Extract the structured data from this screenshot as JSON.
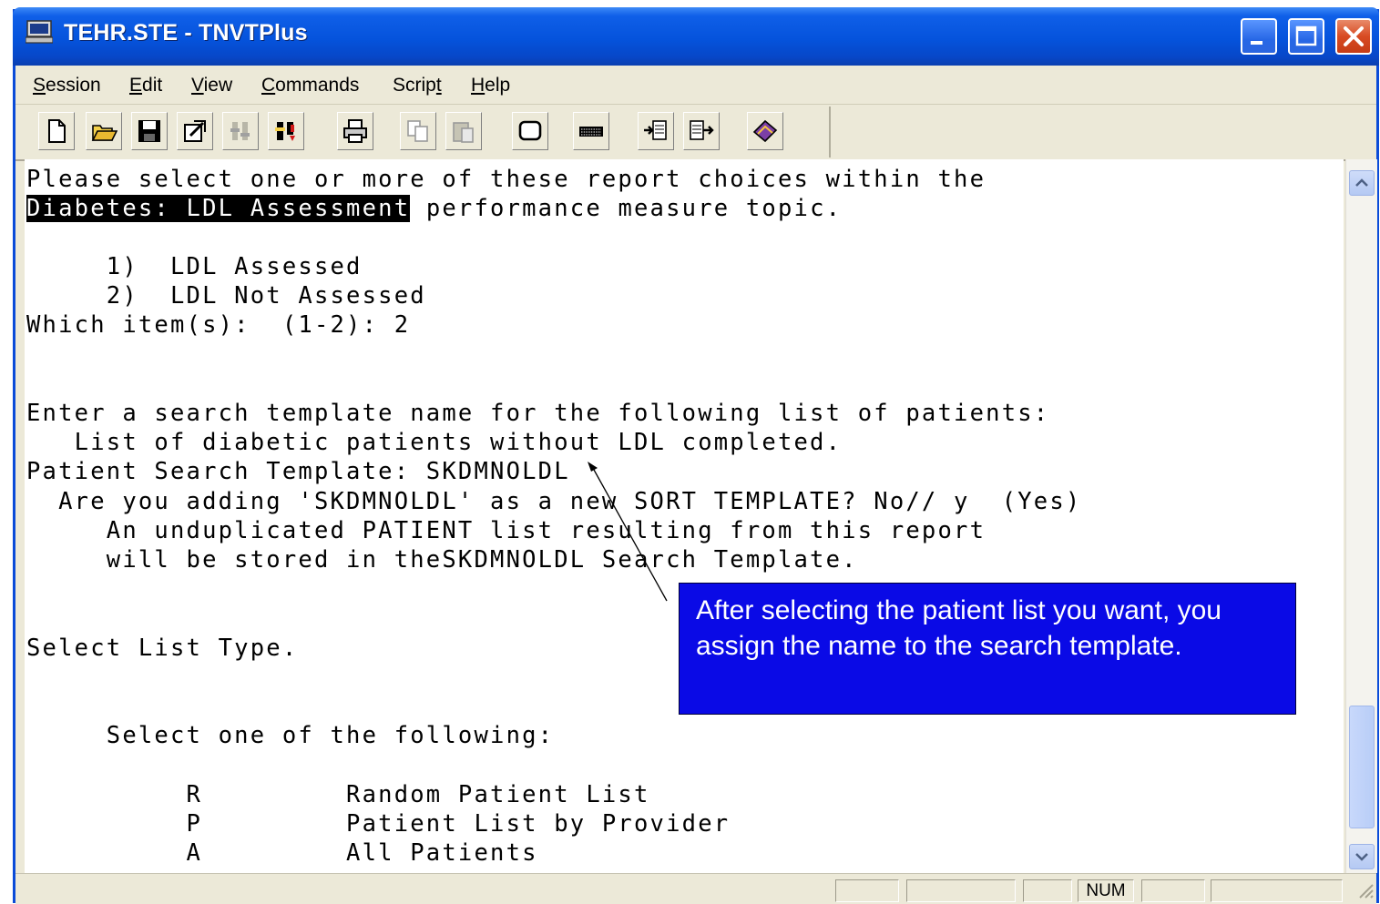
{
  "window": {
    "title": "TEHR.STE - TNVTPlus",
    "controls": [
      "minimize",
      "maximize",
      "close"
    ]
  },
  "menu": {
    "items": [
      {
        "label": "Session",
        "hotkey": "S"
      },
      {
        "label": "Edit",
        "hotkey": "E"
      },
      {
        "label": "View",
        "hotkey": "V"
      },
      {
        "label": "Commands",
        "hotkey": "C"
      },
      {
        "label": "Script",
        "hotkey": "t"
      },
      {
        "label": "Help",
        "hotkey": "H"
      }
    ]
  },
  "toolbar": {
    "icons": [
      "new-icon",
      "open-icon",
      "save-icon",
      "properties-icon",
      "settings-disabled-icon",
      "settings-icon",
      "print-icon",
      "copy-icon",
      "paste-icon",
      "screen-icon",
      "keyboard-icon",
      "receive-file-icon",
      "send-file-icon",
      "help-book-icon"
    ]
  },
  "terminal": {
    "lines": [
      "Please select one or more of these report choices within the",
      "",
      "",
      "     1)  LDL Assessed",
      "     2)  LDL Not Assessed",
      "Which item(s):  (1-2): 2",
      "",
      "",
      "Enter a search template name for the following list of patients:",
      "   List of diabetic patients without LDL completed.",
      "Patient Search Template: SKDMNOLDL",
      "  Are you adding 'SKDMNOLDL' as a new SORT TEMPLATE? No// y  (Yes)",
      "     An unduplicated PATIENT list resulting from this report",
      "     will be stored in theSKDMNOLDL Search Template.",
      "",
      "",
      "Select List Type.",
      "",
      "",
      "     Select one of the following:",
      "",
      "          R         Random Patient List",
      "          P         Patient List by Provider",
      "          A         All Patients"
    ],
    "highlighted_topic": "Diabetes: LDL Assessment",
    "line2_rest": " performance measure topic."
  },
  "callout": {
    "text": "After selecting the patient list you want, you assign the name to the search template."
  },
  "statusbar": {
    "num_indicator": "NUM"
  },
  "colors": {
    "title_bar": "#0553dc",
    "callout_bg": "#0a0ae6",
    "chrome": "#ece9d8"
  }
}
